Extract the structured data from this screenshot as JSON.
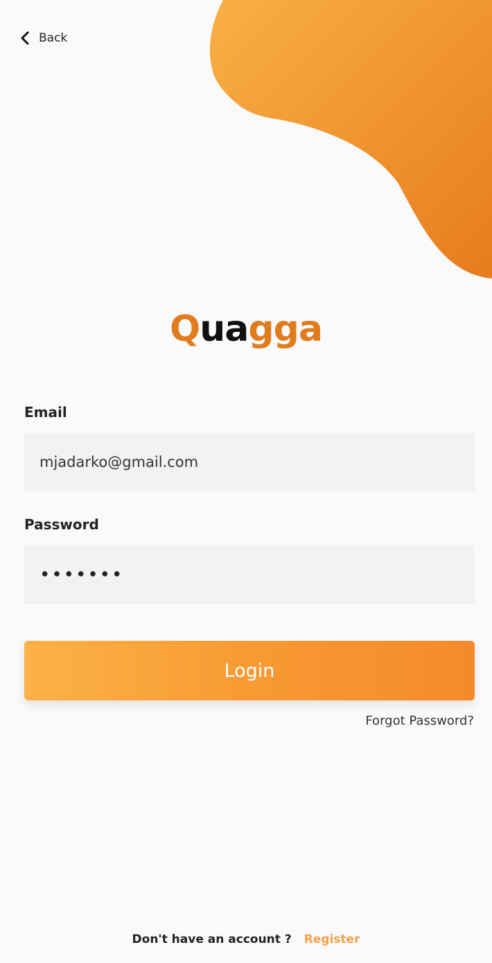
{
  "nav": {
    "back_label": "Back"
  },
  "brand": {
    "name": "Quagga",
    "letters": [
      {
        "ch": "Q",
        "tone": "o"
      },
      {
        "ch": "u",
        "tone": "b"
      },
      {
        "ch": "a",
        "tone": "b"
      },
      {
        "ch": "g",
        "tone": "o"
      },
      {
        "ch": "g",
        "tone": "o"
      },
      {
        "ch": "a",
        "tone": "o"
      }
    ],
    "accent_color": "#e07c1e",
    "dark_color": "#111111"
  },
  "form": {
    "email_label": "Email",
    "email_value": "mjadarko@gmail.com",
    "password_label": "Password",
    "password_value": "•••••••",
    "login_label": "Login",
    "forgot_label": "Forgot Password?"
  },
  "footer": {
    "prompt": "Don't have an account ?",
    "register_label": "Register"
  },
  "colors": {
    "background": "#fafafa",
    "field_bg": "#f2f2f2",
    "button_gradient_start": "#fbb246",
    "button_gradient_end": "#f58a2b",
    "blob_start": "#f9b046",
    "blob_end": "#e77b1d",
    "register_link": "#f5a14a"
  },
  "icons": {
    "back": "chevron-left-icon"
  }
}
